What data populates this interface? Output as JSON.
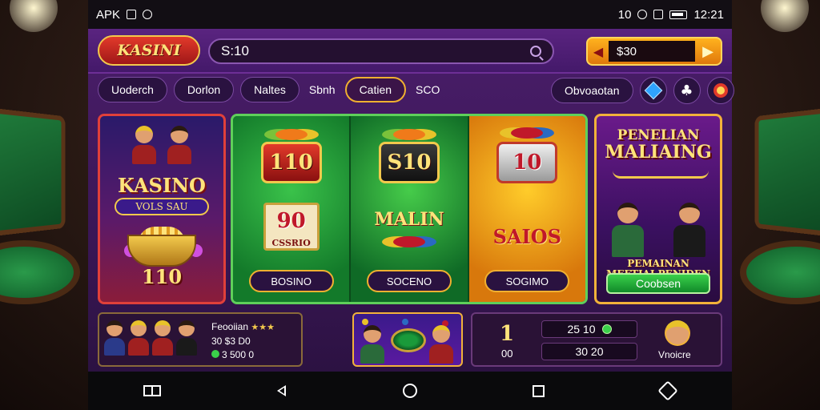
{
  "status_bar": {
    "left_text": "APK",
    "right_text": "10",
    "time": "12:21"
  },
  "app": {
    "logo": "KASINI",
    "search": {
      "value": "S:10"
    },
    "balance": {
      "value": "$30"
    }
  },
  "tabs": [
    {
      "label": "Uoderch"
    },
    {
      "label": "Dorlon"
    },
    {
      "label": "Naltes"
    },
    {
      "label": "Sbnh"
    },
    {
      "label": "Catien"
    },
    {
      "label": "SCO"
    }
  ],
  "right_tab": {
    "label": "Obvoaotan"
  },
  "icons": {
    "gem_button": "diamond-icon",
    "club_button": "club-icon",
    "ring_button": "ring-icon"
  },
  "cards": {
    "kasino": {
      "title": "KASINO",
      "subtitle": "VOLS SAU",
      "number": "110"
    },
    "slots": [
      {
        "number": "110",
        "sub_number": "90",
        "sub_label": "CSSRIO",
        "button": "BOSINO"
      },
      {
        "number": "S10",
        "sub_label": "MALIN",
        "button": "SOCENO"
      },
      {
        "number": "10",
        "sub_label": "SAIOS",
        "button": "SOGIMO"
      }
    ],
    "promo": {
      "title_line1": "PENELIAN",
      "title_line2": "MALIAING",
      "caption_line1": "PEMAINAN",
      "caption_line2": "MEFTIAI PENIDEN",
      "button": "Coobsen"
    }
  },
  "bottom": {
    "players": {
      "title": "Feooiian",
      "line2": "30 $3 D0",
      "line3": "3 500 0"
    },
    "stats": {
      "big": "1",
      "small": "00",
      "box1": "25 10",
      "box2": "30 20",
      "avatar_label": "Vnoicre"
    }
  },
  "navbar": {
    "icons": [
      "menu-icon",
      "back-icon",
      "home-icon",
      "recents-icon",
      "assistant-icon"
    ]
  }
}
